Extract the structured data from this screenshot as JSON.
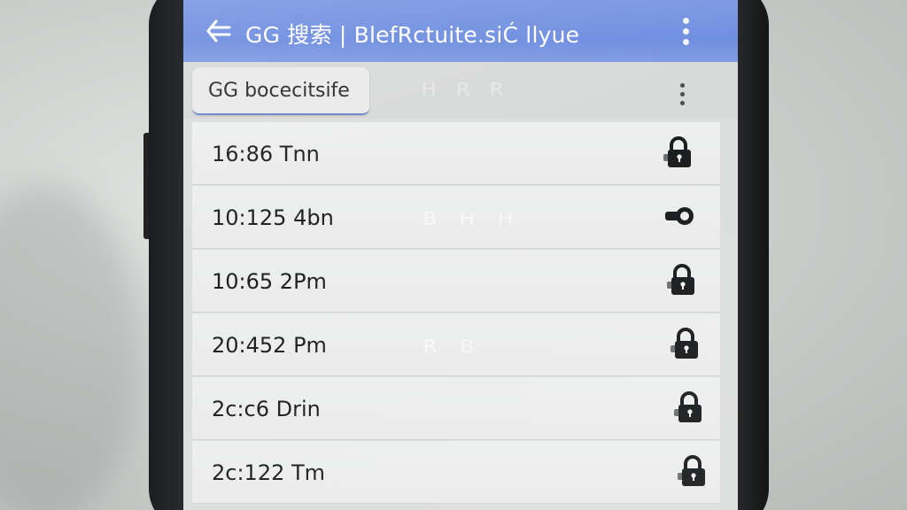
{
  "app_bar": {
    "title": "GG 搜索 | BlefRctuite.siĆ llyue",
    "back_icon": "arrow-left-icon",
    "menu_icon": "more-vertical-icon",
    "color": "#7d9ae3"
  },
  "toolbar": {
    "chip_label": "GG bocecitsife",
    "menu_icon": "more-vertical-icon"
  },
  "list": {
    "items": [
      {
        "time": "16:86 Tnn",
        "icon": "lock-icon"
      },
      {
        "time": "10:125 4bn",
        "icon": "toggle-icon"
      },
      {
        "time": "10:65 2Pm",
        "icon": "lock-icon"
      },
      {
        "time": "20:452 Pm",
        "icon": "lock-icon"
      },
      {
        "time": "2c:c6 Drin",
        "icon": "lock-icon"
      },
      {
        "time": "2c:122 Tm",
        "icon": "lock-icon"
      }
    ]
  }
}
